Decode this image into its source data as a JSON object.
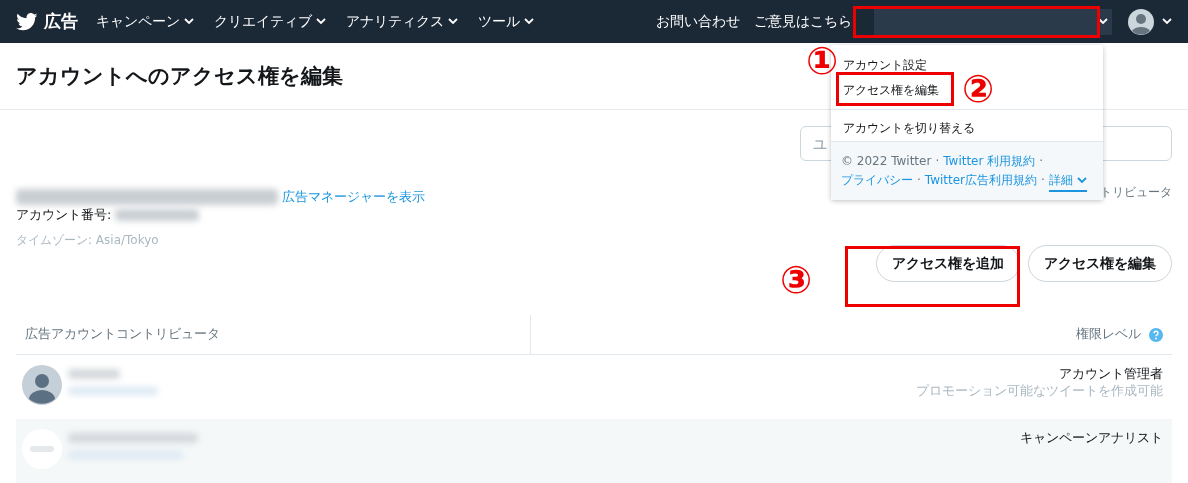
{
  "nav": {
    "logo": "広告",
    "menus": [
      {
        "label": "キャンペーン"
      },
      {
        "label": "クリエイティブ"
      },
      {
        "label": "アナリティクス"
      },
      {
        "label": "ツール"
      }
    ],
    "links": [
      "お問い合わせ",
      "ご意見はこちら"
    ]
  },
  "page_title": "アカウントへのアクセス権を編集",
  "search": {
    "placeholder": "ユ"
  },
  "account": {
    "manager_link": "広告マネージャーを表示",
    "number_label": "アカウント番号:",
    "timezone": "タイムゾーン: Asia/Tokyo"
  },
  "behind_text": "トリビュータ",
  "buttons": [
    "アクセス権を追加",
    "アクセス権を編集"
  ],
  "table": {
    "columns": [
      "広告アカウントコントリビュータ",
      "権限レベル"
    ],
    "rows": [
      {
        "kind": "default",
        "role": "アカウント管理者",
        "detail": "プロモーション可能なツイートを作成可能"
      },
      {
        "kind": "logo",
        "role": "キャンペーンアナリスト"
      }
    ]
  },
  "dropdown": {
    "items": [
      "アカウント設定",
      "アクセス権を編集",
      "アカウントを切り替える"
    ],
    "footer": [
      {
        "text": "© 2022 Twitter",
        "kind": "plain"
      },
      {
        "text": "·",
        "kind": "sep"
      },
      {
        "text": "Twitter 利用規約",
        "kind": "link"
      },
      {
        "text": "·",
        "kind": "sep"
      },
      {
        "text": "プライバシー",
        "kind": "link"
      },
      {
        "text": "·",
        "kind": "sep"
      },
      {
        "text": "Twitter広告利用規約",
        "kind": "link"
      },
      {
        "text": "·",
        "kind": "sep"
      },
      {
        "text": "詳細",
        "kind": "more"
      }
    ]
  },
  "annotations": [
    "①",
    "②",
    "③"
  ]
}
